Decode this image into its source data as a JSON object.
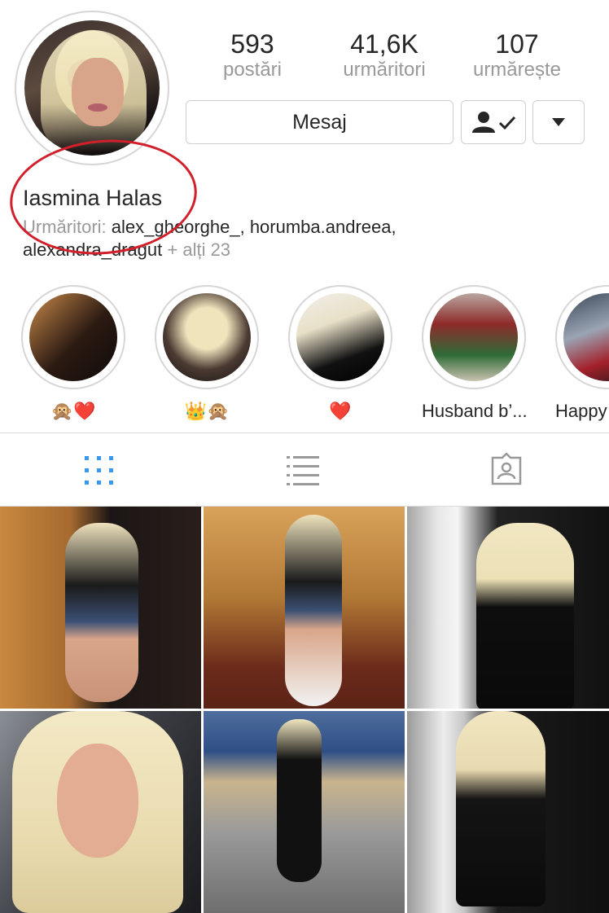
{
  "profile": {
    "name": "Iasmina Halas",
    "followed_by_label": "Urmăritori:",
    "followed_by_users": "alex_gheorghe_, horumba.andreea,",
    "followed_by_user3": "alexandra_dragut",
    "followed_by_more": "+ alți 23"
  },
  "stats": {
    "posts": {
      "value": "593",
      "label": "postări"
    },
    "followers": {
      "value": "41,6K",
      "label": "urmăritori"
    },
    "following": {
      "value": "107",
      "label": "urmărește"
    }
  },
  "actions": {
    "message_label": "Mesaj",
    "following_icon": "person-check-icon",
    "more_icon": "caret-down-icon"
  },
  "highlights": [
    {
      "caption": "🙊❤️"
    },
    {
      "caption": "👑🙊"
    },
    {
      "caption": "❤️"
    },
    {
      "caption": "Husband b’..."
    },
    {
      "caption": "Happy"
    }
  ],
  "tabs": [
    {
      "icon": "grid-icon",
      "active": true
    },
    {
      "icon": "list-icon",
      "active": false
    },
    {
      "icon": "tagged-icon",
      "active": false
    }
  ],
  "colors": {
    "accent": "#3897f0",
    "annotation": "#d11f2b",
    "text": "#262626",
    "muted": "#999999"
  }
}
